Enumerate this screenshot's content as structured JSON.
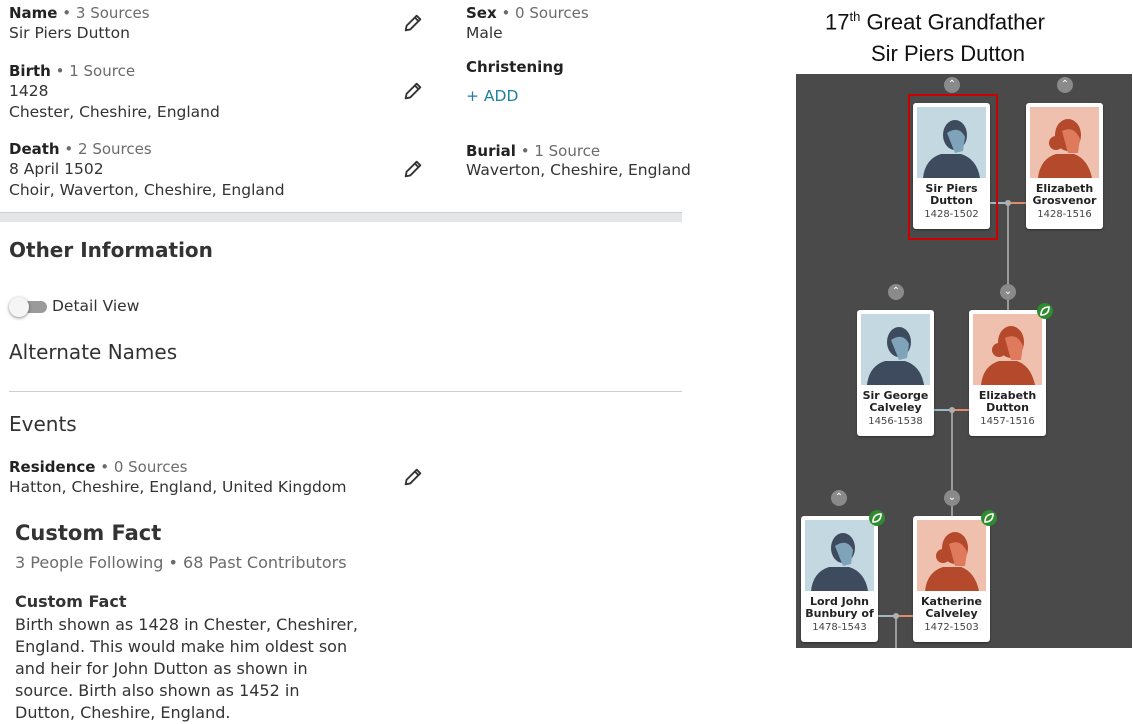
{
  "vitals": {
    "name": {
      "label": "Name",
      "sources": "• 3 Sources",
      "value": "Sir Piers Dutton"
    },
    "sex": {
      "label": "Sex",
      "sources": "• 0 Sources",
      "value": "Male"
    },
    "birth": {
      "label": "Birth",
      "sources": "• 1 Source",
      "date": "1428",
      "place": "Chester, Cheshire, England"
    },
    "christening": {
      "label": "Christening",
      "add": "+ ADD"
    },
    "death": {
      "label": "Death",
      "sources": "• 2 Sources",
      "date": "8 April 1502",
      "place": "Choir, Waverton, Cheshire, England"
    },
    "burial": {
      "label": "Burial",
      "sources": "• 1 Source",
      "place": "Waverton, Cheshire, England"
    }
  },
  "other": {
    "title": "Other Information",
    "detail_view_label": "Detail View",
    "detail_view_on": false,
    "alternate_names_title": "Alternate Names",
    "events_title": "Events",
    "residence": {
      "label": "Residence",
      "sources": "• 0 Sources",
      "place": "Hatton, Cheshire, England, United Kingdom"
    }
  },
  "custom_fact": {
    "title": "Custom Fact",
    "meta": "3 People Following • 68 Past Contributors",
    "subtitle": "Custom Fact",
    "lines": [
      "Birth shown as 1428 in Chester, Cheshirer,",
      "England. This would make him oldest son",
      "and heir for John Dutton as shown in",
      "source. Birth also shown as 1452 in",
      "Dutton, Cheshire, England."
    ]
  },
  "tree": {
    "heading_ordinal": "17",
    "heading_suffix": "th",
    "heading_rest": " Great Grandfather",
    "heading_name": "Sir Piers Dutton",
    "people": {
      "piers": {
        "name1": "Sir Piers",
        "name2": "Dutton",
        "dates": "1428-1502",
        "gender": "male"
      },
      "elizabeth_g": {
        "name1": "Elizabeth",
        "name2": "Grosvenor",
        "dates": "1428-1516",
        "gender": "female"
      },
      "george": {
        "name1": "Sir George",
        "name2": "Calveley",
        "dates": "1456-1538",
        "gender": "male"
      },
      "elizabeth_d": {
        "name1": "Elizabeth",
        "name2": "Dutton",
        "dates": "1457-1516",
        "gender": "female"
      },
      "john": {
        "name1": "Lord John",
        "name2": "Bunbury of",
        "dates": "1478-1543",
        "gender": "male"
      },
      "katherine": {
        "name1": "Katherine",
        "name2": "Calveley",
        "dates": "1472-1503",
        "gender": "female"
      }
    },
    "colors": {
      "background": "#4a4a4a",
      "male_bg": "#c4d8e2",
      "male_fg": "#3e4a5e",
      "female_bg": "#efc0ae",
      "female_fg": "#b5492c",
      "selected": "#cc0000",
      "leaf": "#2e8b2e"
    }
  },
  "icons": {
    "edit": "pencil-icon",
    "chevron_up": "chevron-up-icon",
    "chevron_down": "chevron-down-icon",
    "record_hint": "leaf-hint-icon"
  }
}
